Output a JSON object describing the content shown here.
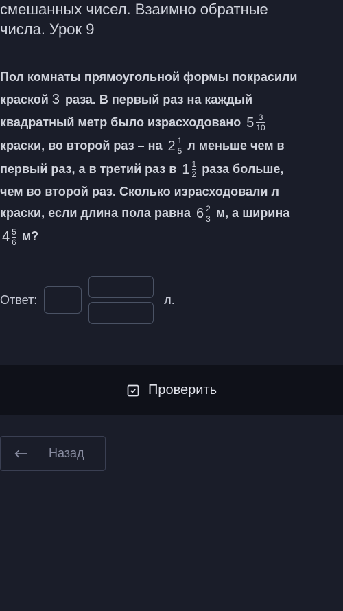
{
  "header": {
    "title_line1": "смешанных чисел. Взаимно обратные",
    "title_line2": "числа. Урок 9"
  },
  "problem": {
    "text_parts": {
      "p1": "Пол комнаты прямоугольной формы покрасили",
      "p2": "краской ",
      "times": "3",
      "p3": " раза. В первый раз на каждый",
      "p4": "квадратный метр было израсходовано ",
      "p5": "краски, во второй раз – на ",
      "p6": " л меньше чем в",
      "p7": "первый раз, а в третий раз в ",
      "p8": " раза больше,",
      "p9": "чем во второй раз. Сколько израсходовали л",
      "p10": "краски, если длина пола равна ",
      "p11": " м, а ширина",
      "p12": " м?"
    },
    "fractions": {
      "f1": {
        "whole": "5",
        "num": "3",
        "den": "10"
      },
      "f2": {
        "whole": "2",
        "num": "1",
        "den": "5"
      },
      "f3": {
        "whole": "1",
        "num": "1",
        "den": "2"
      },
      "f4": {
        "whole": "6",
        "num": "2",
        "den": "3"
      },
      "f5": {
        "whole": "4",
        "num": "5",
        "den": "6"
      }
    }
  },
  "answer": {
    "label": "Ответ:",
    "unit": "л."
  },
  "buttons": {
    "check": "Проверить",
    "back": "Назад"
  }
}
